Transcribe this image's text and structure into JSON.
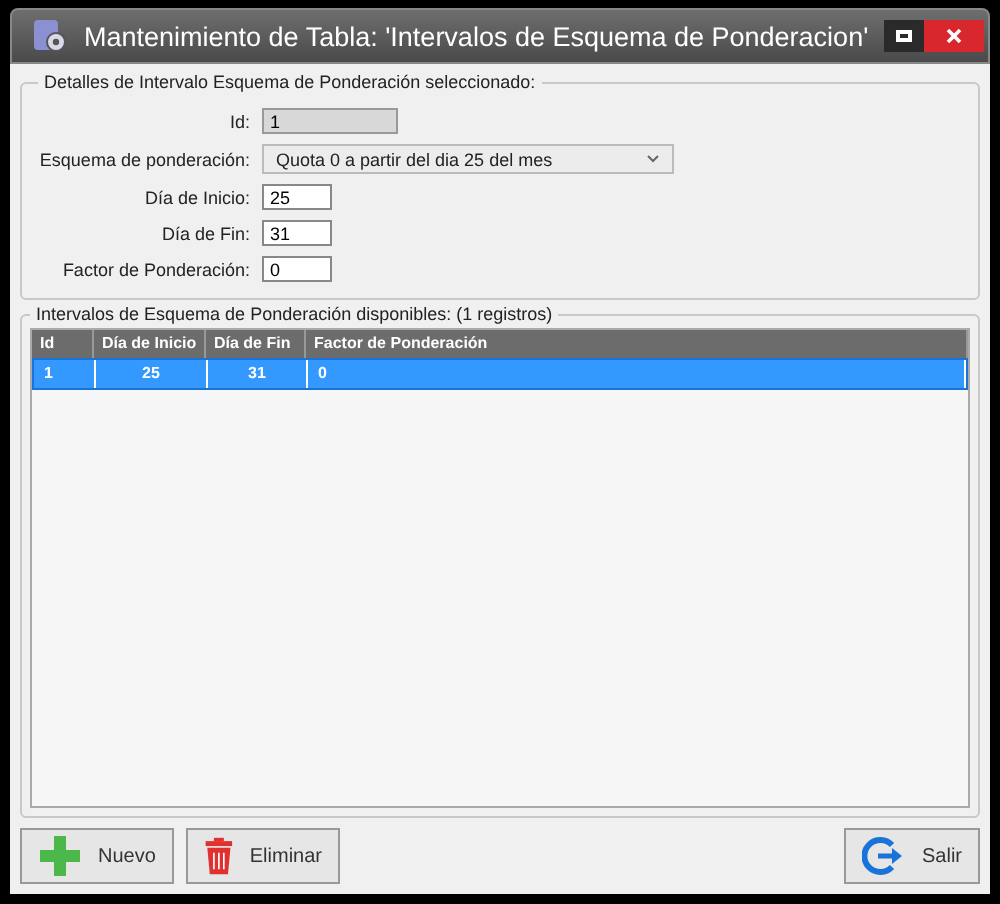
{
  "window": {
    "title": "Mantenimiento de Tabla: 'Intervalos de Esquema de Ponderacion'"
  },
  "details": {
    "legend": "Detalles de Intervalo Esquema de Ponderación seleccionado:",
    "fields": [
      {
        "label": "Id:",
        "value": "1",
        "kind": "readonly"
      },
      {
        "label": "Esquema de ponderación:",
        "value": "Quota 0 a partir del dia 25 del mes",
        "kind": "combo"
      },
      {
        "label": "Día de Inicio:",
        "value": "25",
        "kind": "text"
      },
      {
        "label": "Día de Fin:",
        "value": "31",
        "kind": "text"
      },
      {
        "label": "Factor de Ponderación:",
        "value": "0",
        "kind": "text"
      }
    ]
  },
  "list": {
    "legend": "Intervalos de Esquema de Ponderación disponibles:  (1 registros)",
    "table": {
      "columns": [
        "Id",
        "Día de Inicio",
        "Día de Fin",
        "Factor de Ponderación"
      ],
      "rows": [
        {
          "cells": [
            "1",
            "25",
            "31",
            "0"
          ],
          "selected": true
        }
      ]
    }
  },
  "buttons": [
    {
      "label": "Nuevo",
      "kind": "add"
    },
    {
      "label": "Eliminar",
      "kind": "delete"
    },
    {
      "label": "Salir",
      "kind": "exit"
    }
  ]
}
